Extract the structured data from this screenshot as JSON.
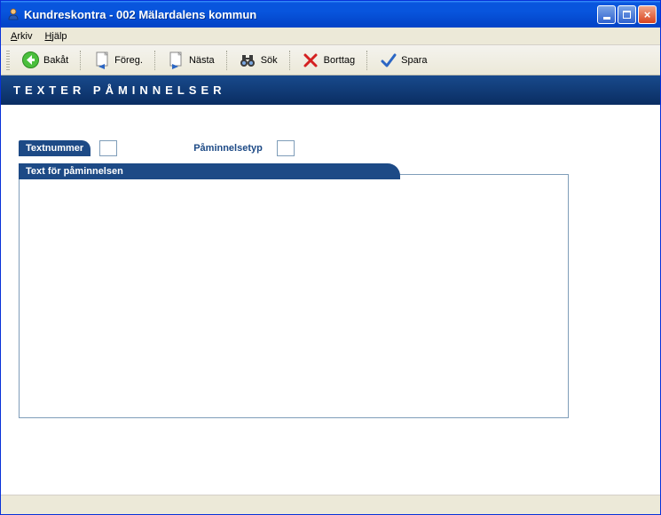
{
  "titlebar": {
    "title": "Kundreskontra  -  002 Mälardalens kommun"
  },
  "menubar": {
    "arkiv": "Arkiv",
    "hjalp": "Hjälp"
  },
  "toolbar": {
    "back": "Bakåt",
    "prev": "Föreg.",
    "next": "Nästa",
    "search": "Sök",
    "delete": "Borttag",
    "save": "Spara"
  },
  "section": {
    "title": "TEXTER  PÅMINNELSER"
  },
  "fields": {
    "textnummer_label": "Textnummer",
    "textnummer_value": "",
    "paminnelsetyp_label": "Påminnelsetyp",
    "paminnelsetyp_value": "",
    "group_label": "Text för påminnelsen",
    "text_value": ""
  }
}
